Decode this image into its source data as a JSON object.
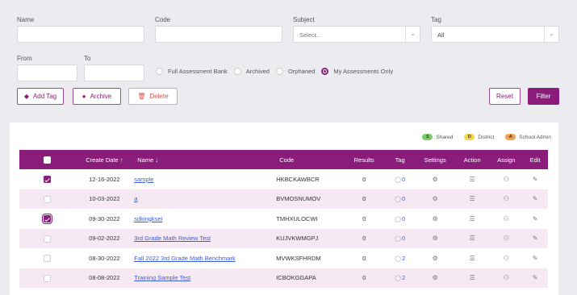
{
  "filters": {
    "name_label": "Name",
    "code_label": "Code",
    "subject_label": "Subject",
    "subject_value": "Select...",
    "tag_label": "Tag",
    "tag_value": "All",
    "from_label": "From",
    "to_label": "To",
    "radios": [
      {
        "label": "Full Assessment Bank",
        "selected": false
      },
      {
        "label": "Archived",
        "selected": false
      },
      {
        "label": "Orphaned",
        "selected": false
      },
      {
        "label": "My Assessments Only",
        "selected": true
      }
    ]
  },
  "actions": {
    "add_tag": "Add Tag",
    "archive": "Archive",
    "delete": "Delete",
    "reset": "Reset",
    "filter": "Filter"
  },
  "legend": [
    {
      "badge": "S",
      "label": "Shared",
      "color": "#7ccf6a"
    },
    {
      "badge": "D",
      "label": "District",
      "color": "#f6d64a"
    },
    {
      "badge": "A",
      "label": "School Admin",
      "color": "#f0a15a"
    }
  ],
  "table": {
    "headers": {
      "create_date": "Create Date",
      "name": "Name",
      "code": "Code",
      "results": "Results",
      "tag": "Tag",
      "settings": "Settings",
      "action": "Action",
      "assign": "Assign",
      "edit": "Edit"
    },
    "rows": [
      {
        "checked": true,
        "date": "12-16-2022",
        "name": "sample",
        "code": "HKBCKAWBCR",
        "results": "0",
        "tag": "0"
      },
      {
        "checked": false,
        "date": "10-03-2022",
        "name": "a",
        "code": "BVMOSNUMOV",
        "results": "0",
        "tag": "0"
      },
      {
        "checked": true,
        "date": "09-30-2022",
        "name": "sdkingksei",
        "code": "TMHXULOCWI",
        "results": "0",
        "tag": "0"
      },
      {
        "checked": false,
        "date": "09-02-2022",
        "name": "3rd Grade Math Review Test",
        "code": "KUJVKWMGPJ",
        "results": "0",
        "tag": "0"
      },
      {
        "checked": false,
        "date": "08-30-2022",
        "name": "Fall 2022 3rd Grade Math Benchmark",
        "code": "MVWKSFHRDM",
        "results": "0",
        "tag": "2"
      },
      {
        "checked": false,
        "date": "08-08-2022",
        "name": "Training Sample Test",
        "code": "ICBOKGGAPA",
        "results": "0",
        "tag": "2"
      }
    ]
  },
  "colors": {
    "accent": "#8a1d7c",
    "row_alt": "#f7e9f4",
    "link": "#3b5cd6"
  }
}
